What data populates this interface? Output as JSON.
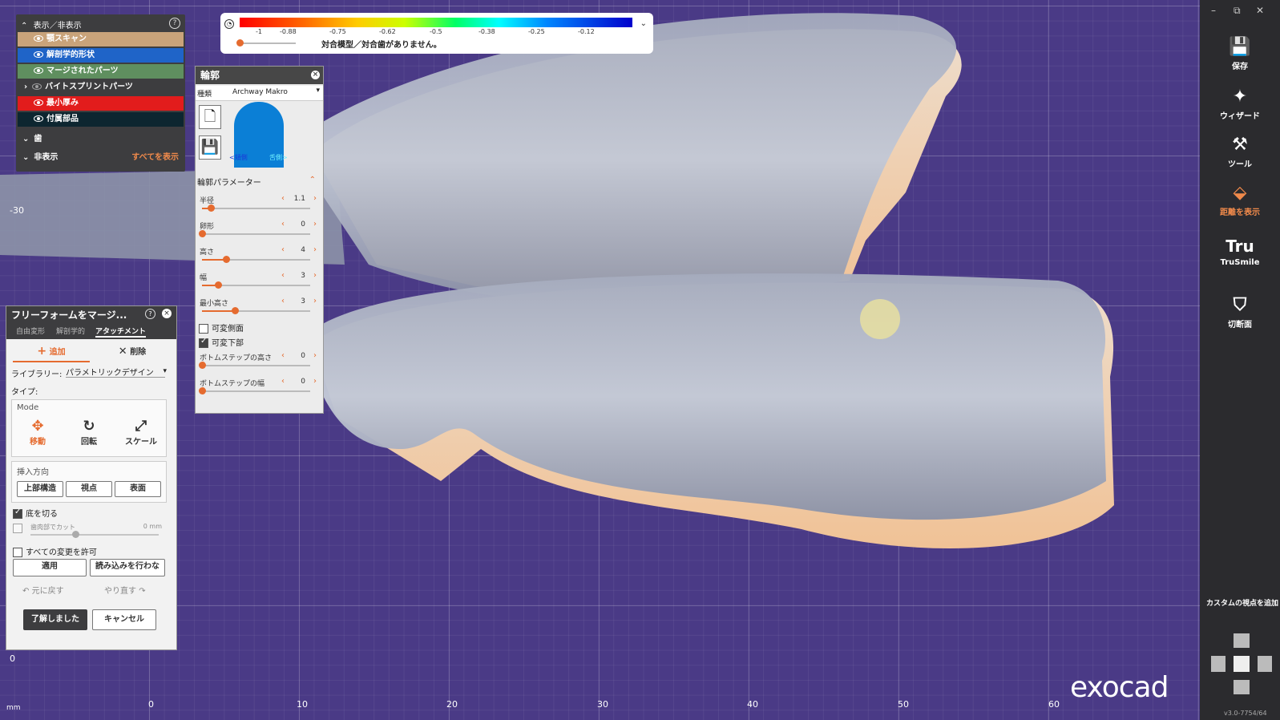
{
  "viewport": {
    "ruler_x": [
      "0",
      "10",
      "20",
      "30",
      "40",
      "50",
      "60"
    ],
    "ruler_y": [
      "-30",
      "0"
    ],
    "unit": "mm",
    "logo": "exocad",
    "version": "v3.0-7754/64"
  },
  "colorbar": {
    "ticks": [
      "-1",
      "-0.88",
      "-0.75",
      "-0.62",
      "-0.5",
      "-0.38",
      "-0.25",
      "-0.12"
    ],
    "message": "対合模型／対合歯がありません。"
  },
  "visibility_panel": {
    "title": "表示／非表示",
    "items": [
      {
        "label": "顎スキャン",
        "color": "#c9a37a"
      },
      {
        "label": "解剖学的形状",
        "color": "#1f64c8"
      },
      {
        "label": "マージされたパーツ",
        "color": "#5f8f5f"
      },
      {
        "label": "バイトスプリントパーツ",
        "color": "#3d3d3f"
      },
      {
        "label": "最小厚み",
        "color": "#e21c1c"
      },
      {
        "label": "付属部品",
        "color": "#0d2630"
      }
    ],
    "group_teeth": "歯",
    "group_hidden": "非表示",
    "show_all": "すべてを表示"
  },
  "rim_panel": {
    "title": "輪郭",
    "type_label": "種類",
    "type_value": "Archway Makro",
    "preview_left": "<頬側",
    "preview_right": "舌側>",
    "section": "輪郭パラメーター",
    "params": [
      {
        "label": "半径",
        "value": "1.1",
        "fraction": 0.08
      },
      {
        "label": "卵形",
        "value": "0",
        "fraction": 0.0
      },
      {
        "label": "高さ",
        "value": "4",
        "fraction": 0.22
      },
      {
        "label": "幅",
        "value": "3",
        "fraction": 0.15
      },
      {
        "label": "最小高さ",
        "value": "3",
        "fraction": 0.3
      }
    ],
    "check_variable_side": "可変側面",
    "check_variable_bottom": "可変下部",
    "bottom_step_height": {
      "label": "ボトムステップの高さ",
      "value": "0",
      "fraction": 0.0
    },
    "bottom_step_width": {
      "label": "ボトムステップの幅",
      "value": "0",
      "fraction": 0.0
    }
  },
  "freeform_panel": {
    "title": "フリーフォームをマージ...",
    "tabs": [
      "自由変形",
      "解剖学的",
      "アタッチメント"
    ],
    "add": "追加",
    "delete": "削除",
    "library_label": "ライブラリー:",
    "library_value": "パラメトリックデザイン",
    "type_label": "タイプ:",
    "mode_title": "Mode",
    "modes": [
      "移動",
      "回転",
      "スケール"
    ],
    "insert_title": "挿入方向",
    "insert_buttons": [
      "上部構造",
      "視点",
      "表面"
    ],
    "cut_bottom": "底を切る",
    "cut_gum": "歯肉部でカット",
    "cut_gum_value": "0 mm",
    "allow_all": "すべての変更を許可",
    "apply": "適用",
    "no_load": "読み込みを行わな",
    "undo": "元に戻す",
    "redo": "やり直す",
    "ok": "了解しました",
    "cancel": "キャンセル"
  },
  "sidebar": {
    "items": [
      "保存",
      "ウィザード",
      "ツール",
      "距離を表示",
      "TruSmile",
      "切断面"
    ],
    "custom_view": "カスタムの視点を追加"
  }
}
